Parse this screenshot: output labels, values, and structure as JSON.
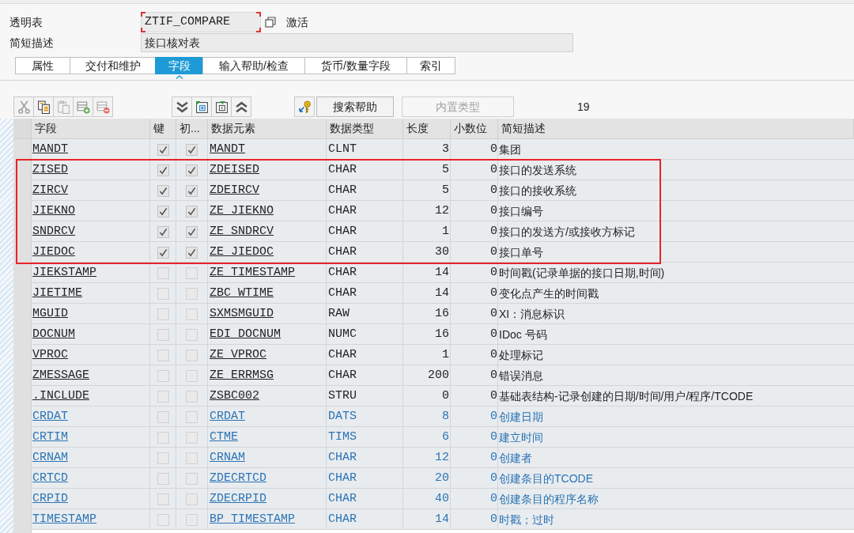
{
  "header": {
    "table_label": "透明表",
    "table_name": {
      "value": "ZTIF_COMPARE",
      "focused": true
    },
    "status": "激活",
    "description_label": "简短描述",
    "description": "接口核对表"
  },
  "tabs": [
    {
      "label": "属性",
      "selected": false
    },
    {
      "label": "交付和维护",
      "selected": false
    },
    {
      "label": "字段",
      "selected": true
    },
    {
      "label": "输入帮助/检查",
      "selected": false
    },
    {
      "label": "货币/数量字段",
      "selected": false
    },
    {
      "label": "索引",
      "selected": false
    }
  ],
  "toolbar": {
    "buttons": [
      {
        "label": "搜索帮助",
        "disabled": false
      },
      {
        "label": "内置类型",
        "disabled": true
      }
    ],
    "field_count": "19"
  },
  "table": {
    "columns": [
      "字段",
      "键",
      "初...",
      "数据元素",
      "数据类型",
      "长度",
      "小数位",
      "简短描述"
    ],
    "rows": [
      {
        "field": "MANDT",
        "key": true,
        "initial": true,
        "data_element": "MANDT",
        "data_type": "CLNT",
        "length": "3",
        "decimals": "0",
        "description": "集团",
        "included": false,
        "highlighted": false
      },
      {
        "field": "ZISED",
        "key": true,
        "initial": true,
        "data_element": "ZDEISED",
        "data_type": "CHAR",
        "length": "5",
        "decimals": "0",
        "description": "接口的发送系统",
        "included": false,
        "highlighted": true
      },
      {
        "field": "ZIRCV",
        "key": true,
        "initial": true,
        "data_element": "ZDEIRCV",
        "data_type": "CHAR",
        "length": "5",
        "decimals": "0",
        "description": "接口的接收系统",
        "included": false,
        "highlighted": true
      },
      {
        "field": "JIEKNO",
        "key": true,
        "initial": true,
        "data_element": "ZE_JIEKNO",
        "data_type": "CHAR",
        "length": "12",
        "decimals": "0",
        "description": "接口编号",
        "included": false,
        "highlighted": true
      },
      {
        "field": "SNDRCV",
        "key": true,
        "initial": true,
        "data_element": "ZE_SNDRCV",
        "data_type": "CHAR",
        "length": "1",
        "decimals": "0",
        "description": "接口的发送方/或接收方标记",
        "included": false,
        "highlighted": true
      },
      {
        "field": "JIEDOC",
        "key": true,
        "initial": true,
        "data_element": "ZE_JIEDOC",
        "data_type": "CHAR",
        "length": "30",
        "decimals": "0",
        "description": "接口单号",
        "included": false,
        "highlighted": true
      },
      {
        "field": "JIEKSTAMP",
        "key": false,
        "initial": false,
        "data_element": "ZE_TIMESTAMP",
        "data_type": "CHAR",
        "length": "14",
        "decimals": "0",
        "description": "时间戳(记录单据的接口日期,时间)",
        "included": false,
        "highlighted": false
      },
      {
        "field": "JIETIME",
        "key": false,
        "initial": false,
        "data_element": "ZBC_WTIME",
        "data_type": "CHAR",
        "length": "14",
        "decimals": "0",
        "description": "变化点产生的时间戳",
        "included": false,
        "highlighted": false
      },
      {
        "field": "MGUID",
        "key": false,
        "initial": false,
        "data_element": "SXMSMGUID",
        "data_type": "RAW",
        "length": "16",
        "decimals": "0",
        "description": "XI：消息标识",
        "included": false,
        "highlighted": false
      },
      {
        "field": "DOCNUM",
        "key": false,
        "initial": false,
        "data_element": "EDI_DOCNUM",
        "data_type": "NUMC",
        "length": "16",
        "decimals": "0",
        "description": "IDoc 号码",
        "included": false,
        "highlighted": false
      },
      {
        "field": "VPROC",
        "key": false,
        "initial": false,
        "data_element": "ZE_VPROC",
        "data_type": "CHAR",
        "length": "1",
        "decimals": "0",
        "description": "处理标记",
        "included": false,
        "highlighted": false
      },
      {
        "field": "ZMESSAGE",
        "key": false,
        "initial": false,
        "data_element": "ZE_ERRMSG",
        "data_type": "CHAR",
        "length": "200",
        "decimals": "0",
        "description": "错误消息",
        "included": false,
        "highlighted": false
      },
      {
        "field": ".INCLUDE",
        "key": false,
        "initial": false,
        "data_element": "ZSBC002",
        "data_type": "STRU",
        "length": "0",
        "decimals": "0",
        "description": "基础表结构-记录创建的日期/时间/用户/程序/TCODE",
        "included": false,
        "highlighted": false
      },
      {
        "field": "CRDAT",
        "key": false,
        "initial": false,
        "data_element": "CRDAT",
        "data_type": "DATS",
        "length": "8",
        "decimals": "0",
        "description": "创建日期",
        "included": true,
        "highlighted": false
      },
      {
        "field": "CRTIM",
        "key": false,
        "initial": false,
        "data_element": "CTME",
        "data_type": "TIMS",
        "length": "6",
        "decimals": "0",
        "description": "建立时间",
        "included": true,
        "highlighted": false
      },
      {
        "field": "CRNAM",
        "key": false,
        "initial": false,
        "data_element": "CRNAM",
        "data_type": "CHAR",
        "length": "12",
        "decimals": "0",
        "description": "创建者",
        "included": true,
        "highlighted": false
      },
      {
        "field": "CRTCD",
        "key": false,
        "initial": false,
        "data_element": "ZDECRTCD",
        "data_type": "CHAR",
        "length": "20",
        "decimals": "0",
        "description": "创建条目的TCODE",
        "included": true,
        "highlighted": false
      },
      {
        "field": "CRPID",
        "key": false,
        "initial": false,
        "data_element": "ZDECRPID",
        "data_type": "CHAR",
        "length": "40",
        "decimals": "0",
        "description": "创建条目的程序名称",
        "included": true,
        "highlighted": false
      },
      {
        "field": "TIMESTAMP",
        "key": false,
        "initial": false,
        "data_element": "BP_TIMESTAMP",
        "data_type": "CHAR",
        "length": "14",
        "decimals": "0",
        "description": "时戳；过时",
        "included": true,
        "highlighted": false
      }
    ]
  }
}
